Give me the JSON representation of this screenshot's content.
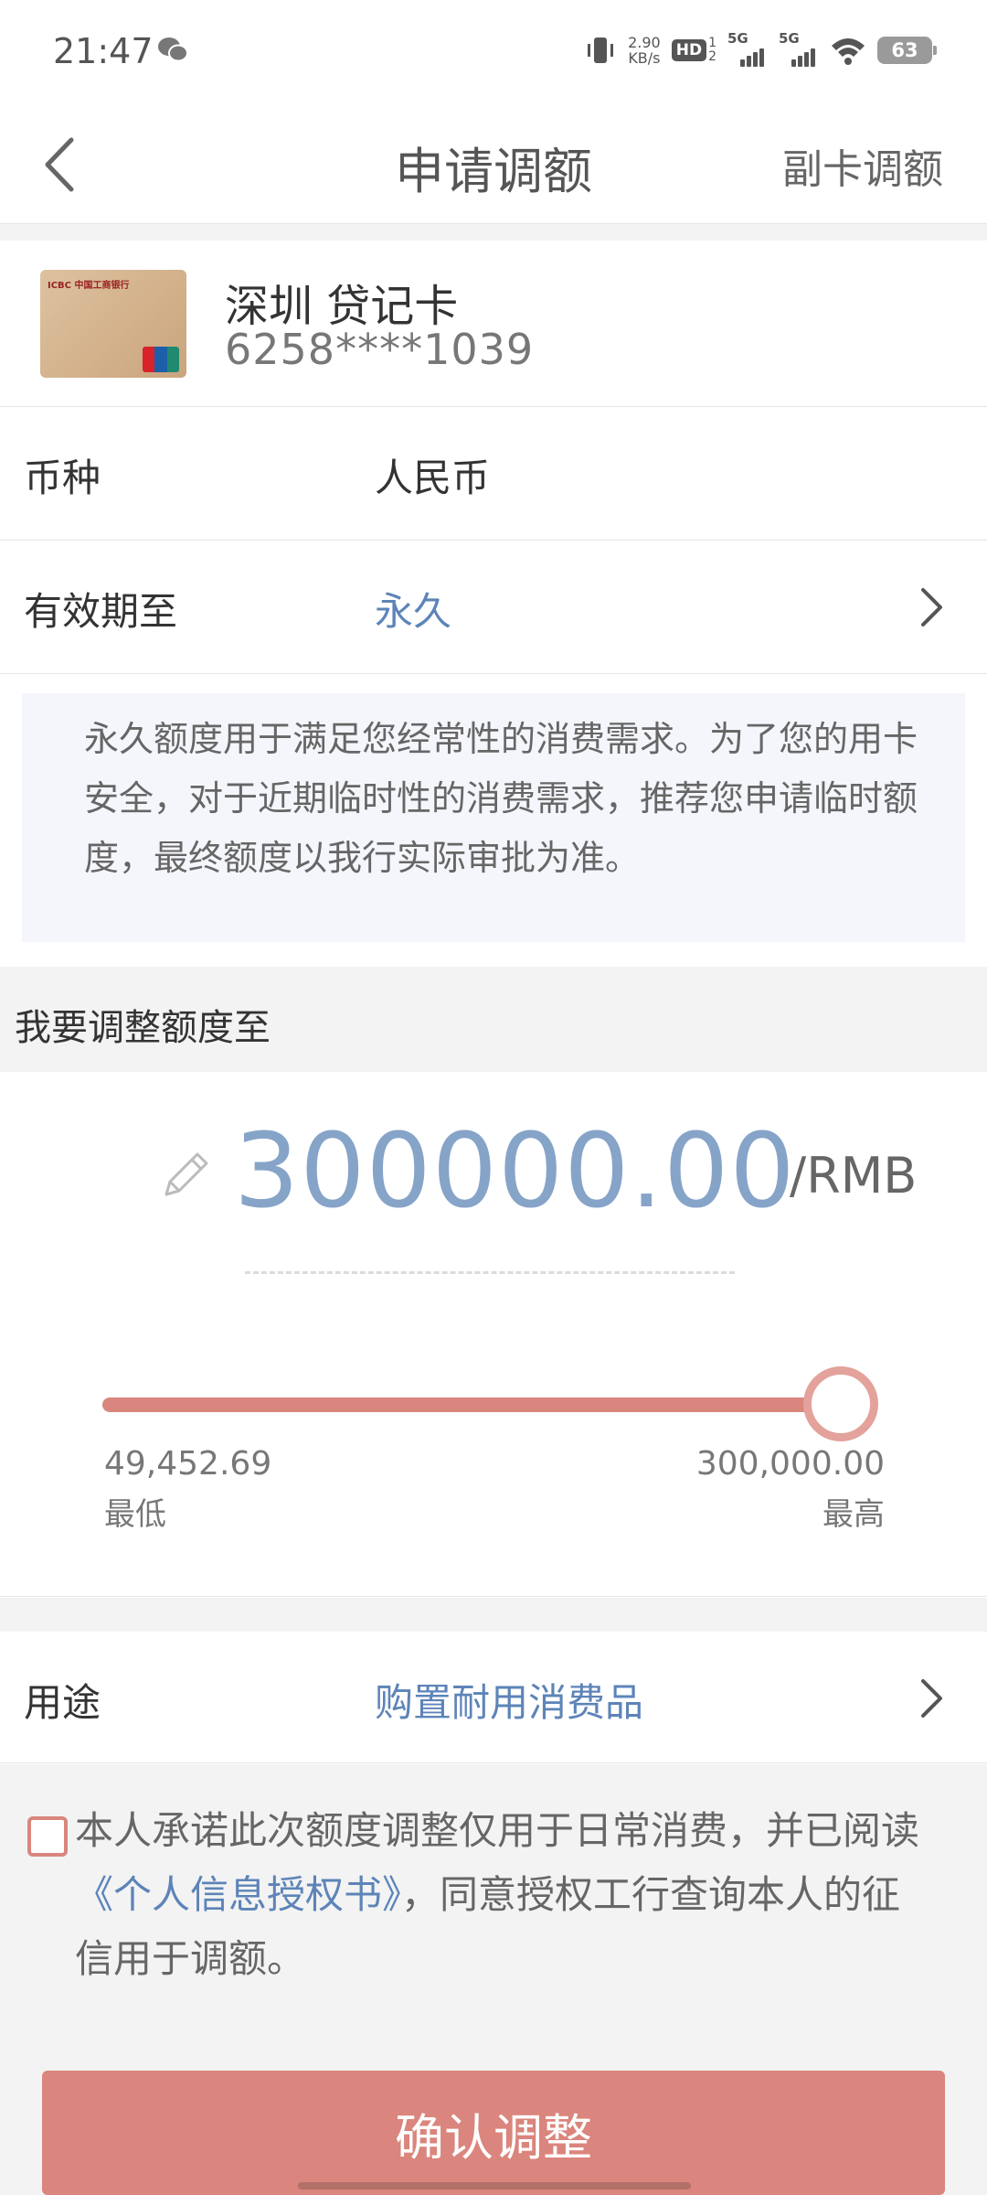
{
  "status_bar": {
    "time": "21:47",
    "net_speed_value": "2.90",
    "net_speed_unit": "KB/s",
    "hd_label": "HD",
    "hd_sub_top": "1",
    "hd_sub_bottom": "2",
    "sim1_label": "5G",
    "sim2_label": "5G",
    "battery": "63"
  },
  "nav": {
    "title": "申请调额",
    "right_action": "副卡调额"
  },
  "card": {
    "name": "深圳  贷记卡",
    "number": "6258****1039",
    "bank_logo_text": "ICBC 中国工商银行"
  },
  "currency": {
    "label": "币种",
    "value": "人民币"
  },
  "validity": {
    "label": "有效期至",
    "value": "永久"
  },
  "notice": "永久额度用于满足您经常性的消费需求。为了您的用卡安全，对于近期临时性的消费需求，推荐您申请临时额度，最终额度以我行实际审批为准。",
  "adjust": {
    "section_title": "我要调整额度至",
    "amount": "300000.00",
    "unit": "/RMB",
    "slider": {
      "min_value": "49,452.69",
      "min_label": "最低",
      "max_value": "300,000.00",
      "max_label": "最高",
      "position_fraction": 1.0
    }
  },
  "purpose": {
    "label": "用途",
    "value": "购置耐用消费品"
  },
  "agreement": {
    "checked": false,
    "text_before": "本人承诺此次额度调整仅用于日常消费，并已阅读",
    "link_text": "《个人信息授权书》",
    "text_after": "，同意授权工行查询本人的征信用于调额。"
  },
  "confirm_button": "确认调整",
  "colors": {
    "accent": "#da857d",
    "link": "#5d84b8",
    "amount": "#86a4c8"
  }
}
